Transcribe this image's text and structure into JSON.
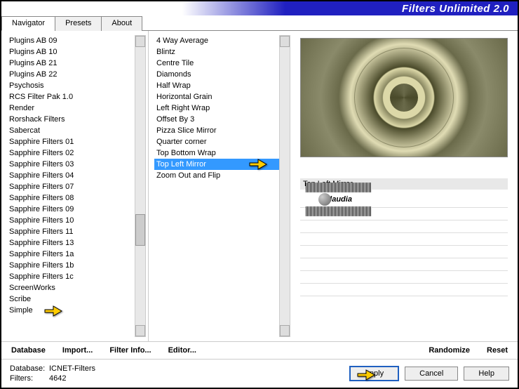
{
  "header": {
    "title": "Filters Unlimited 2.0"
  },
  "tabs": [
    {
      "label": "Navigator",
      "active": true
    },
    {
      "label": "Presets",
      "active": false
    },
    {
      "label": "About",
      "active": false
    }
  ],
  "plugins": [
    "Plugins AB 09",
    "Plugins AB 10",
    "Plugins AB 21",
    "Plugins AB 22",
    "Psychosis",
    "RCS Filter Pak 1.0",
    "Render",
    "Rorshack Filters",
    "Sabercat",
    "Sapphire Filters 01",
    "Sapphire Filters 02",
    "Sapphire Filters 03",
    "Sapphire Filters 04",
    "Sapphire Filters 07",
    "Sapphire Filters 08",
    "Sapphire Filters 09",
    "Sapphire Filters 10",
    "Sapphire Filters 11",
    "Sapphire Filters 13",
    "Sapphire Filters 1a",
    "Sapphire Filters 1b",
    "Sapphire Filters 1c",
    "ScreenWorks",
    "Scribe",
    "Simple"
  ],
  "filters": [
    "4 Way Average",
    "Blintz",
    "Centre Tile",
    "Diamonds",
    "Half Wrap",
    "Horizontal Grain",
    "Left Right Wrap",
    "Offset By 3",
    "Pizza Slice Mirror",
    "Quarter corner",
    "Top Bottom Wrap",
    "Top Left Mirror",
    "Zoom Out and Flip"
  ],
  "selected_filter_index": 11,
  "selected_filter_name": "Top Left Mirror",
  "toolbar": {
    "database": "Database",
    "import": "Import...",
    "filter_info": "Filter Info...",
    "editor": "Editor...",
    "randomize": "Randomize",
    "reset": "Reset"
  },
  "footer": {
    "db_label": "Database:",
    "db_value": "ICNET-Filters",
    "filters_label": "Filters:",
    "filters_value": "4642",
    "apply": "Apply",
    "cancel": "Cancel",
    "help": "Help"
  },
  "watermark": "claudia"
}
